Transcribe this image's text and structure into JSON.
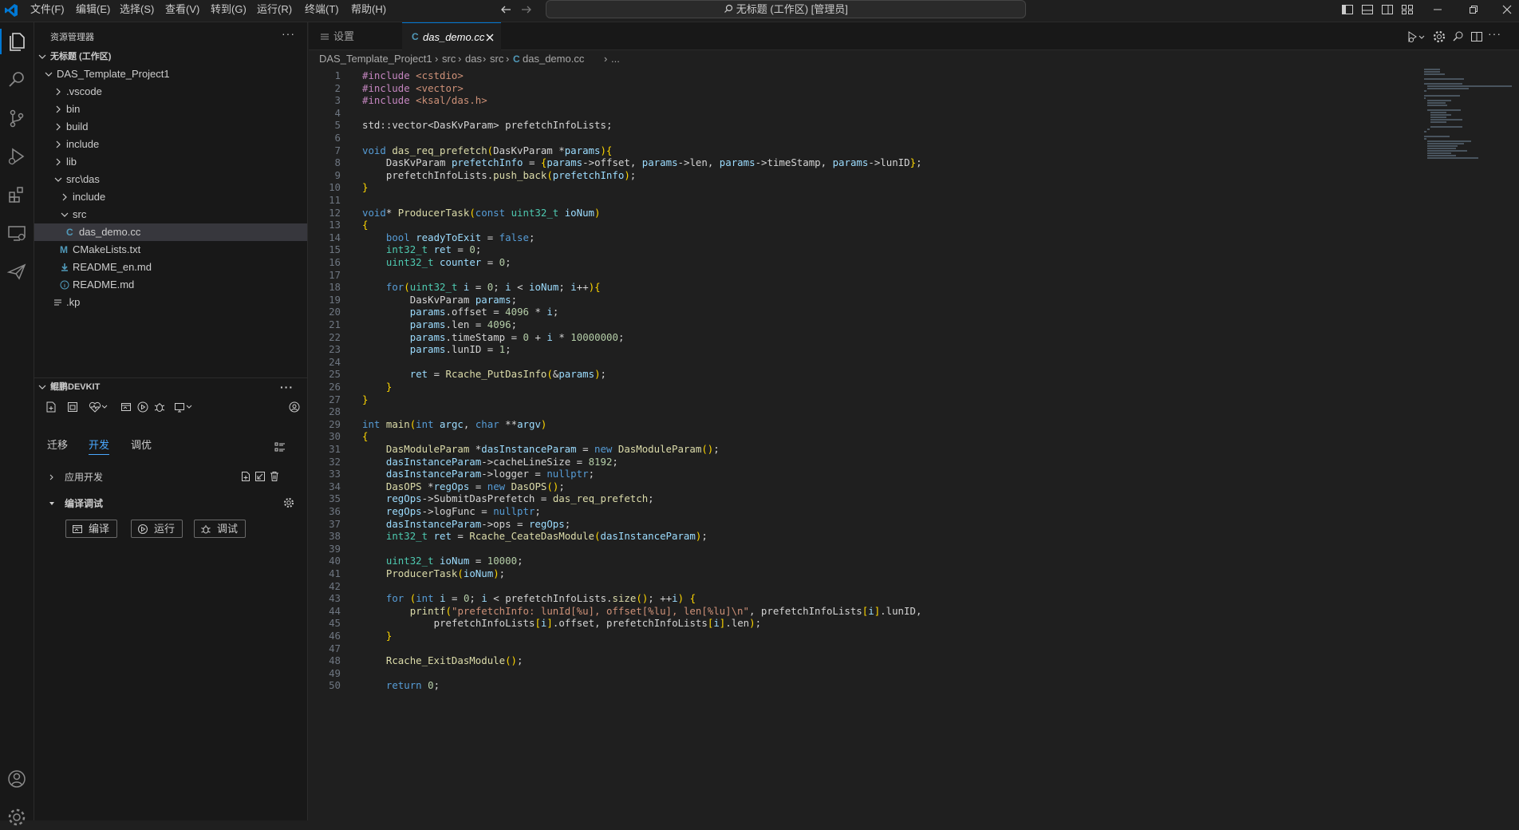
{
  "menu": [
    "文件(F)",
    "编辑(E)",
    "选择(S)",
    "查看(V)",
    "转到(G)",
    "运行(R)",
    "终端(T)",
    "帮助(H)"
  ],
  "search": {
    "text": "无标题 (工作区) [管理员]"
  },
  "sidebar": {
    "title": "资源管理器",
    "workspace": "无标题 (工作区)",
    "tree": [
      {
        "label": "DAS_Template_Project1",
        "indent": 1,
        "kind": "open"
      },
      {
        "label": ".vscode",
        "indent": 2,
        "kind": "closed"
      },
      {
        "label": "bin",
        "indent": 2,
        "kind": "closed"
      },
      {
        "label": "build",
        "indent": 2,
        "kind": "closed"
      },
      {
        "label": "include",
        "indent": 2,
        "kind": "closed"
      },
      {
        "label": "lib",
        "indent": 2,
        "kind": "closed"
      },
      {
        "label": "src\\das",
        "indent": 2,
        "kind": "open"
      },
      {
        "label": "include",
        "indent": 3,
        "kind": "closed"
      },
      {
        "label": "src",
        "indent": 3,
        "kind": "open"
      },
      {
        "label": "das_demo.cc",
        "indent": 4,
        "kind": "cfile",
        "selected": true
      },
      {
        "label": "CMakeLists.txt",
        "indent": 3,
        "kind": "mfile"
      },
      {
        "label": "README_en.md",
        "indent": 3,
        "kind": "dlfile"
      },
      {
        "label": "README.md",
        "indent": 3,
        "kind": "infofile"
      },
      {
        "label": ".kp",
        "indent": 2,
        "kind": "txtfile"
      }
    ],
    "devkit": {
      "title": "鲲鹏DEVKIT",
      "tabs": [
        "迁移",
        "开发",
        "调优"
      ],
      "active_tab": "开发",
      "app_dev": "应用开发",
      "compile_debug": "编译调试",
      "buttons": {
        "compile": "编译",
        "run": "运行",
        "debug": "调试"
      }
    }
  },
  "tabs": [
    {
      "label": "设置",
      "active": false
    },
    {
      "label": "das_demo.cc",
      "active": true
    }
  ],
  "breadcrumb": {
    "parts": [
      "DAS_Template_Project1",
      "src",
      "das",
      "src",
      "das_demo.cc",
      "..."
    ]
  },
  "code_lines": [
    "#include <cstdio>",
    "#include <vector>",
    "#include <ksal/das.h>",
    "",
    "std::vector<DasKvParam> prefetchInfoLists;",
    "",
    "void das_req_prefetch(DasKvParam *params){",
    "    DasKvParam prefetchInfo = {params->offset, params->len, params->timeStamp, params->lunID};",
    "    prefetchInfoLists.push_back(prefetchInfo);",
    "}",
    "",
    "void* ProducerTask(const uint32_t ioNum)",
    "{",
    "    bool readyToExit = false;",
    "    int32_t ret = 0;",
    "    uint32_t counter = 0;",
    "",
    "    for(uint32_t i = 0; i < ioNum; i++){",
    "        DasKvParam params;",
    "        params.offset = 4096 * i;",
    "        params.len = 4096;",
    "        params.timeStamp = 0 + i * 10000000;",
    "        params.lunID = 1;",
    "",
    "        ret = Rcache_PutDasInfo(&params);",
    "    }",
    "}",
    "",
    "int main(int argc, char **argv)",
    "{",
    "    DasModuleParam *dasInstanceParam = new DasModuleParam();",
    "    dasInstanceParam->cacheLineSize = 8192;",
    "    dasInstanceParam->logger = nullptr;",
    "    DasOPS *regOps = new DasOPS();",
    "    regOps->SubmitDasPrefetch = das_req_prefetch;",
    "    regOps->logFunc = nullptr;",
    "    dasInstanceParam->ops = regOps;",
    "    int32_t ret = Rcache_CeateDasModule(dasInstanceParam);",
    "",
    "    uint32_t ioNum = 10000;",
    "    ProducerTask(ioNum);",
    "",
    "    for (int i = 0; i < prefetchInfoLists.size(); ++i) {",
    "        printf(\"prefetchInfo: lunId[%u], offset[%lu], len[%lu]\\n\", prefetchInfoLists[i].lunID,",
    "            prefetchInfoLists[i].offset, prefetchInfoLists[i].len);",
    "    }",
    "",
    "    Rcache_ExitDasModule();",
    "",
    "    return 0;"
  ],
  "colors": {
    "accent": "#0078d4",
    "background": "#1f1f1f",
    "sidebar": "#181818"
  }
}
